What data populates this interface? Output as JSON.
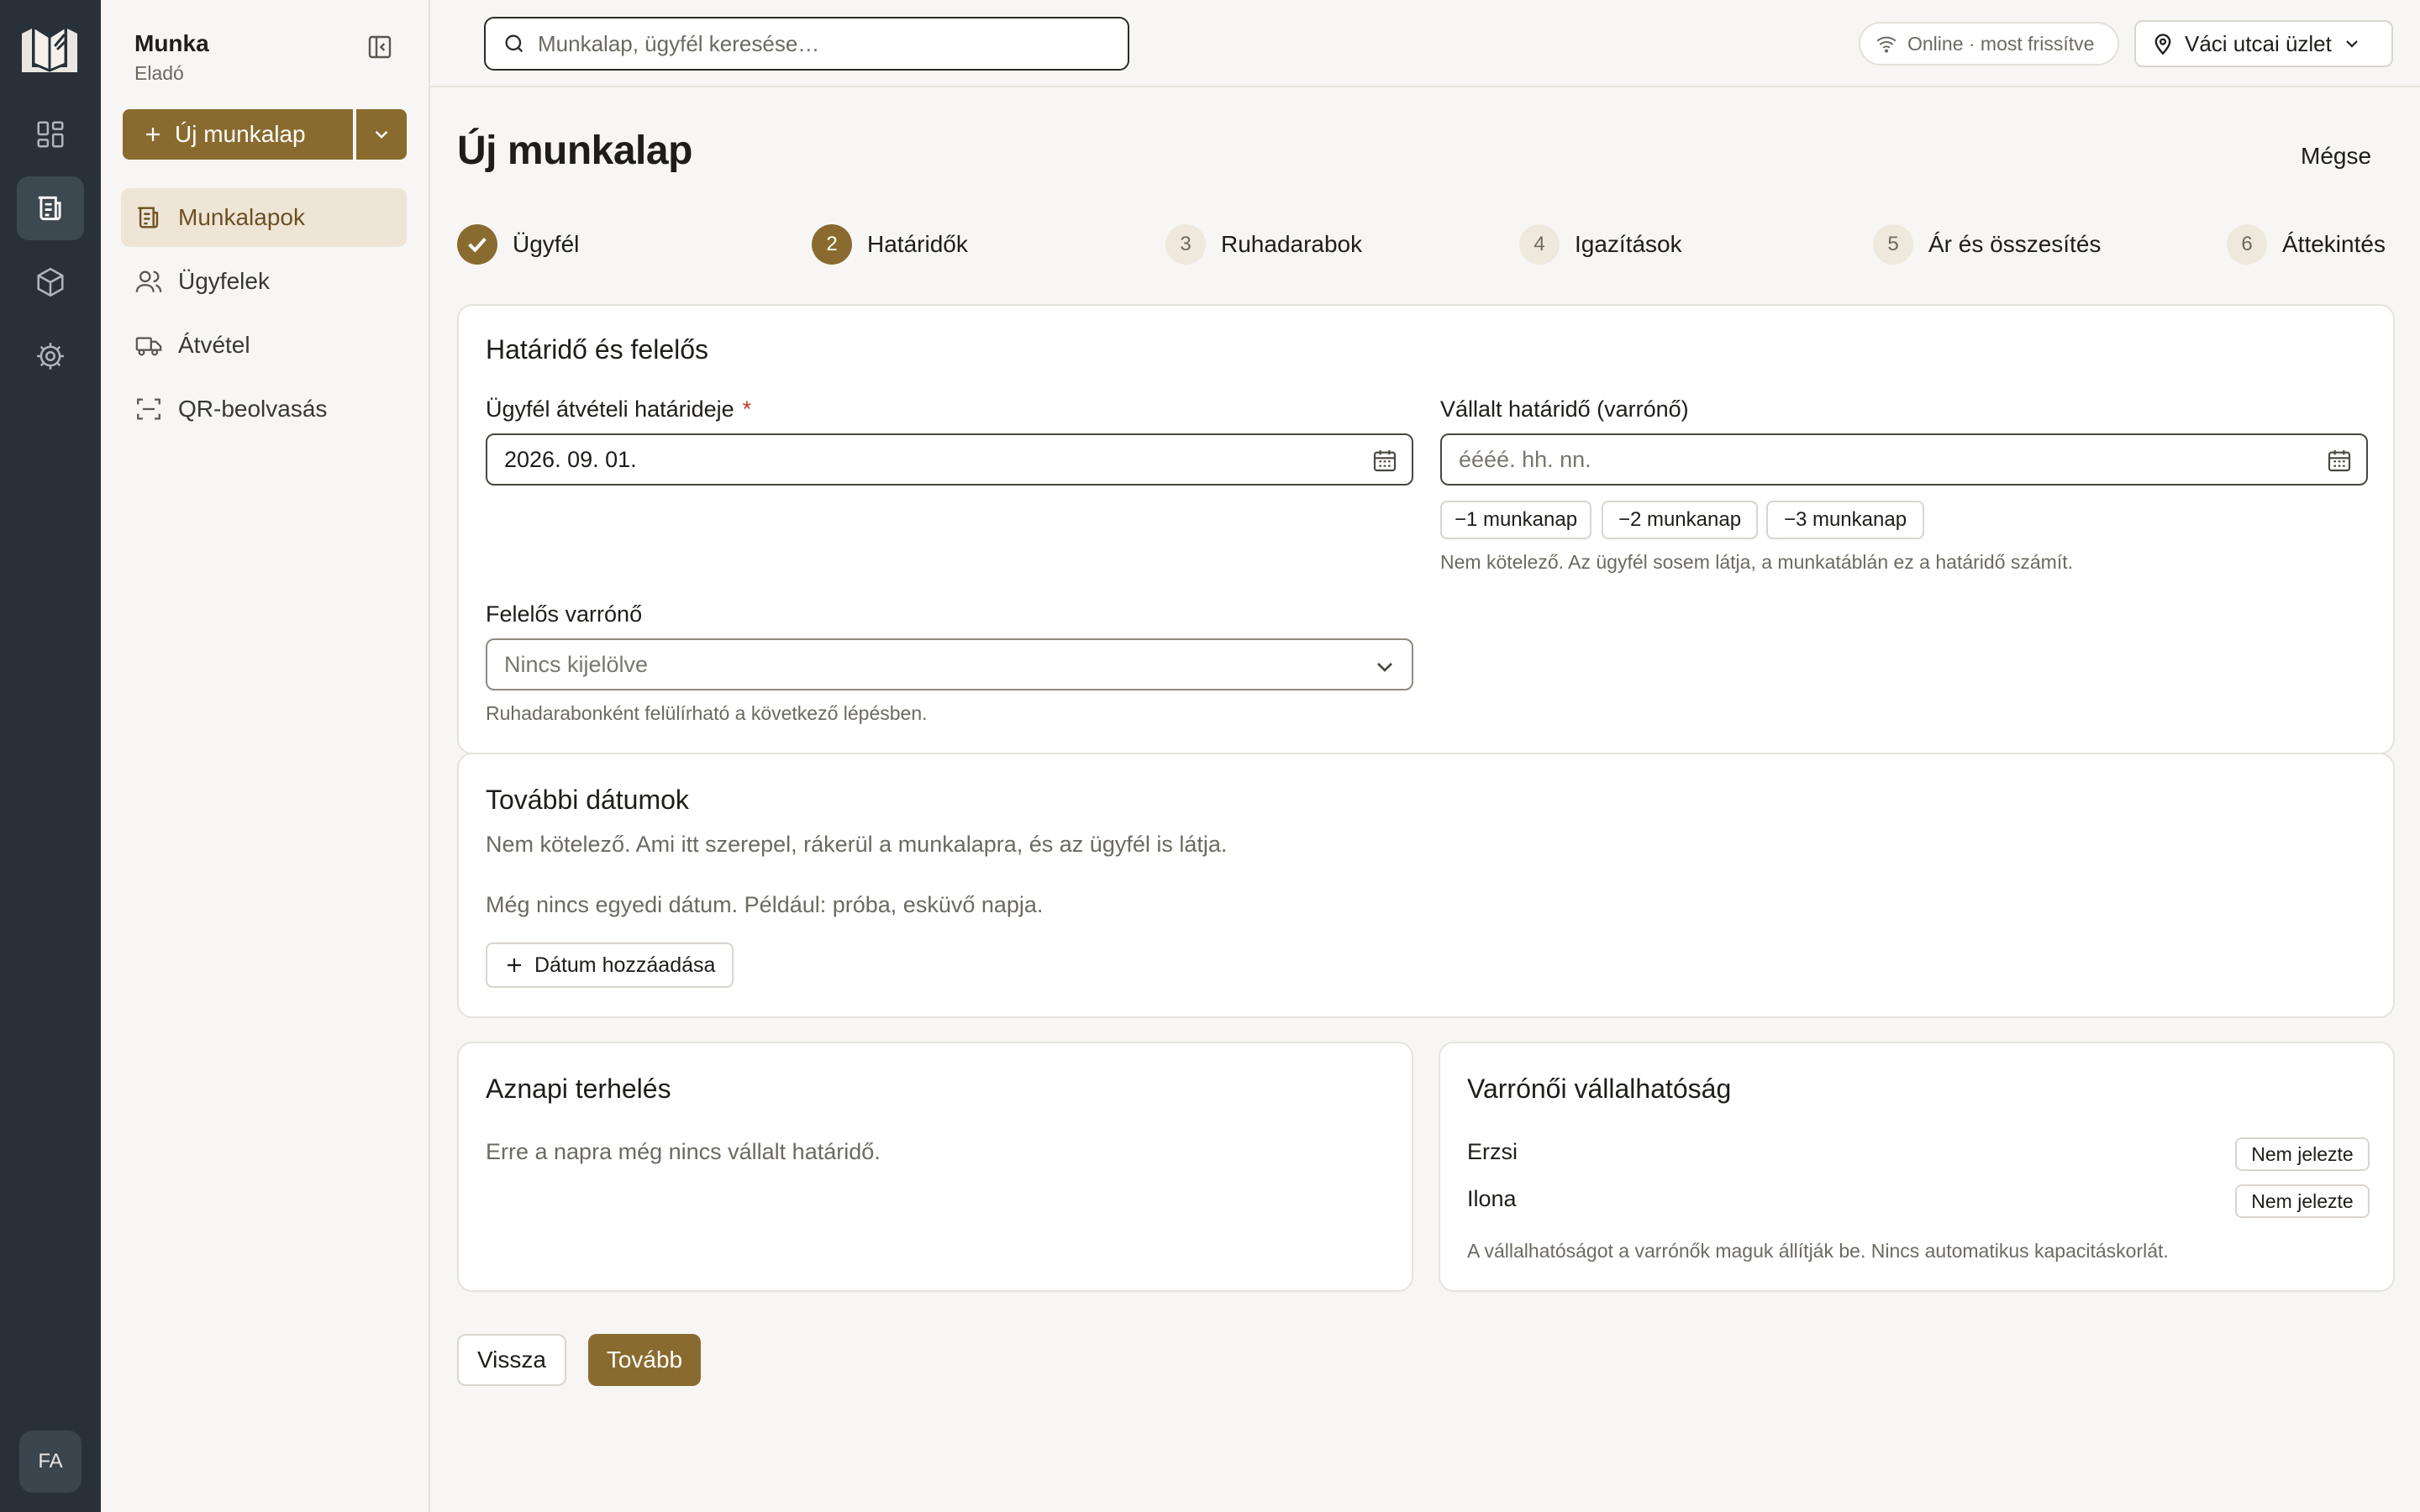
{
  "rail": {
    "items": [
      {
        "icon": "dashboard-icon"
      },
      {
        "icon": "worksheets-icon",
        "active": true
      },
      {
        "icon": "package-icon"
      },
      {
        "icon": "gear-icon"
      }
    ],
    "avatar_initials": "FA"
  },
  "sidebar": {
    "workspace_name": "Munka",
    "workspace_role": "Eladó",
    "new_button_label": "Új munkalap",
    "items": [
      {
        "label": "Munkalapok",
        "icon": "worksheet-icon",
        "active": true
      },
      {
        "label": "Ügyfelek",
        "icon": "users-icon"
      },
      {
        "label": "Átvétel",
        "icon": "truck-icon"
      },
      {
        "label": "QR-beolvasás",
        "icon": "qr-scan-icon"
      }
    ]
  },
  "topbar": {
    "search_placeholder": "Munkalap, ügyfél keresése…",
    "status_text": "Online · most frissítve",
    "store_label": "Váci utcai üzlet"
  },
  "page": {
    "title": "Új munkalap",
    "cancel_label": "Mégse"
  },
  "steps": [
    {
      "number": "1",
      "label": "Ügyfél",
      "state": "done"
    },
    {
      "number": "2",
      "label": "Határidők",
      "state": "current"
    },
    {
      "number": "3",
      "label": "Ruhadarabok",
      "state": "todo"
    },
    {
      "number": "4",
      "label": "Igazítások",
      "state": "todo"
    },
    {
      "number": "5",
      "label": "Ár és összesítés",
      "state": "todo"
    },
    {
      "number": "6",
      "label": "Áttekintés",
      "state": "todo"
    }
  ],
  "deadline_card": {
    "title": "Határidő és felelős",
    "customer_deadline_label": "Ügyfél átvételi határideje",
    "required_mark": "*",
    "customer_deadline_value": "2026. 09. 01.",
    "tailor_deadline_label": "Vállalt határidő (varrónő)",
    "tailor_deadline_placeholder": "éééé. hh. nn.",
    "chips": [
      "−1 munkanap",
      "−2 munkanap",
      "−3 munkanap"
    ],
    "tailor_deadline_hint": "Nem kötelező. Az ügyfél sosem látja, a munkatáblán ez a határidő számít.",
    "responsible_label": "Felelős varrónő",
    "responsible_value": "Nincs kijelölve",
    "responsible_hint": "Ruhadarabonként felülírható a következő lépésben."
  },
  "dates_card": {
    "title": "További dátumok",
    "subtitle": "Nem kötelező. Ami itt szerepel, rákerül a munkalapra, és az ügyfél is látja.",
    "empty_text": "Még nincs egyedi dátum. Például: próba, esküvő napja.",
    "add_button_label": "Dátum hozzáadása"
  },
  "load_card": {
    "title": "Aznapi terhelés",
    "empty_text": "Erre a napra még nincs vállalt határidő."
  },
  "availability_card": {
    "title": "Varrónői vállalhatóság",
    "rows": [
      {
        "name": "Erzsi",
        "status": "Nem jelezte"
      },
      {
        "name": "Ilona",
        "status": "Nem jelezte"
      }
    ],
    "footnote": "A vállalhatóságot a varrónők maguk állítják be. Nincs automatikus kapacitáskorlát."
  },
  "footer": {
    "back_label": "Vissza",
    "next_label": "Tovább"
  },
  "colors": {
    "accent": "#8a6b2f",
    "rail_bg": "#283138",
    "active_nav_bg": "#eee5d6"
  }
}
